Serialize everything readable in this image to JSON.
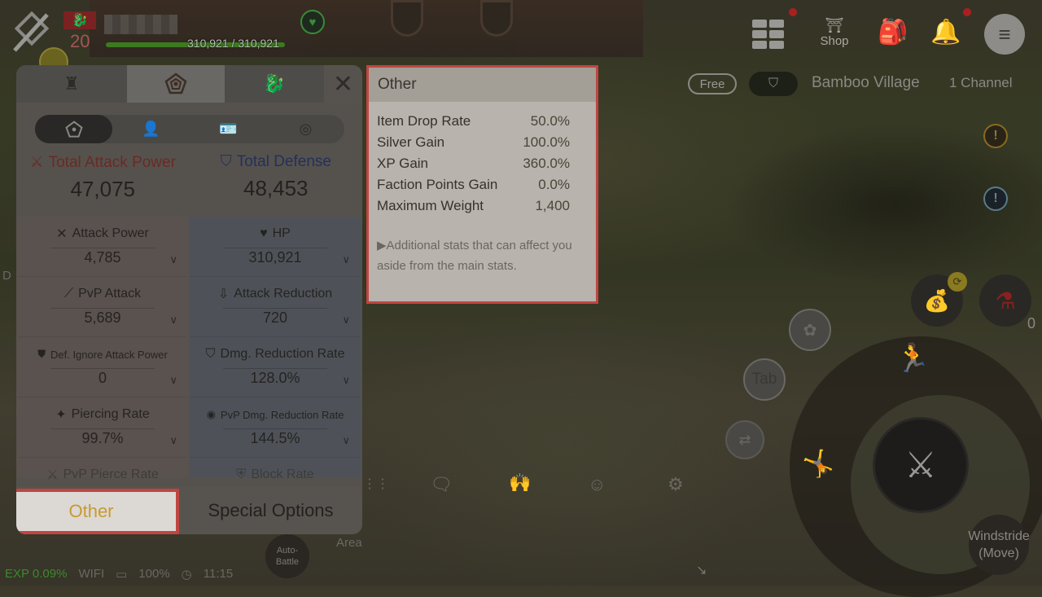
{
  "hud": {
    "level_icon": "dragon-emblem-icon",
    "level": "20",
    "hp_text": "310,921 / 310,921",
    "hp_fraction": 1.0,
    "status_icon": "heart-icon"
  },
  "panel": {
    "tabs": [
      {
        "icon": "character-equipment-icon",
        "active": false
      },
      {
        "icon": "pentagon-stats-icon",
        "active": true
      },
      {
        "icon": "dragon-icon",
        "active": false
      }
    ],
    "close_icon": "close-icon",
    "subtabs": [
      {
        "icon": "pentagon-stats-icon",
        "active": true
      },
      {
        "icon": "person-icon",
        "active": false
      },
      {
        "icon": "person-card-icon",
        "active": false
      },
      {
        "icon": "coin-icon",
        "active": false
      }
    ],
    "total_attack": {
      "label": "Total Attack Power",
      "value": "47,075"
    },
    "total_defense": {
      "label": "Total Defense",
      "value": "48,453"
    },
    "stats_left": [
      {
        "name": "Attack Power",
        "value": "4,785",
        "icon": "crossed-swords-icon"
      },
      {
        "name": "PvP Attack",
        "value": "5,689",
        "icon": "dagger-icon"
      },
      {
        "name": "Def. Ignore Attack Power",
        "value": "0",
        "icon": "broken-shield-icon"
      },
      {
        "name": "Piercing Rate",
        "value": "99.7%",
        "icon": "pierce-icon"
      },
      {
        "name": "PvP Pierce Rate",
        "value": "",
        "icon": "pvp-pierce-icon"
      }
    ],
    "stats_right": [
      {
        "name": "HP",
        "value": "310,921",
        "icon": "heart-icon"
      },
      {
        "name": "Attack Reduction",
        "value": "720",
        "icon": "down-arrow-icon"
      },
      {
        "name": "Dmg. Reduction Rate",
        "value": "128.0%",
        "icon": "shield-icon"
      },
      {
        "name": "PvP Dmg. Reduction Rate",
        "value": "144.5%",
        "icon": "target-shield-icon"
      },
      {
        "name": "Block Rate",
        "value": "",
        "icon": "block-shield-icon"
      }
    ],
    "bottom_tabs": {
      "other": "Other",
      "special": "Special Options"
    }
  },
  "tooltip": {
    "title": "Other",
    "rows": [
      {
        "label": "Item Drop Rate",
        "value": "50.0%"
      },
      {
        "label": "Silver Gain",
        "value": "100.0%"
      },
      {
        "label": "XP Gain",
        "value": "360.0%"
      },
      {
        "label": "Faction Points Gain",
        "value": "0.0%"
      },
      {
        "label": "Maximum Weight",
        "value": "1,400"
      }
    ],
    "note": "▶Additional stats that can affect you aside from the main stats."
  },
  "top_right": {
    "shop_label": "Shop",
    "free_label": "Free",
    "location": "Bamboo Village",
    "channel": "1 Channel"
  },
  "controls": {
    "tab_label": "Tab",
    "windstride_label": "Windstride (Move)",
    "auto_battle_label": "Auto-Battle",
    "area_label": "Area",
    "potion_count": "0"
  },
  "status_bar": {
    "exp": "EXP 0.09%",
    "network": "WIFI",
    "battery": "100%",
    "time": "11:15"
  },
  "colors": {
    "highlight_border": "#c04540",
    "other_tab_text": "#c89a30",
    "attack_label": "#6b2a24",
    "defense_label": "#24305a"
  }
}
